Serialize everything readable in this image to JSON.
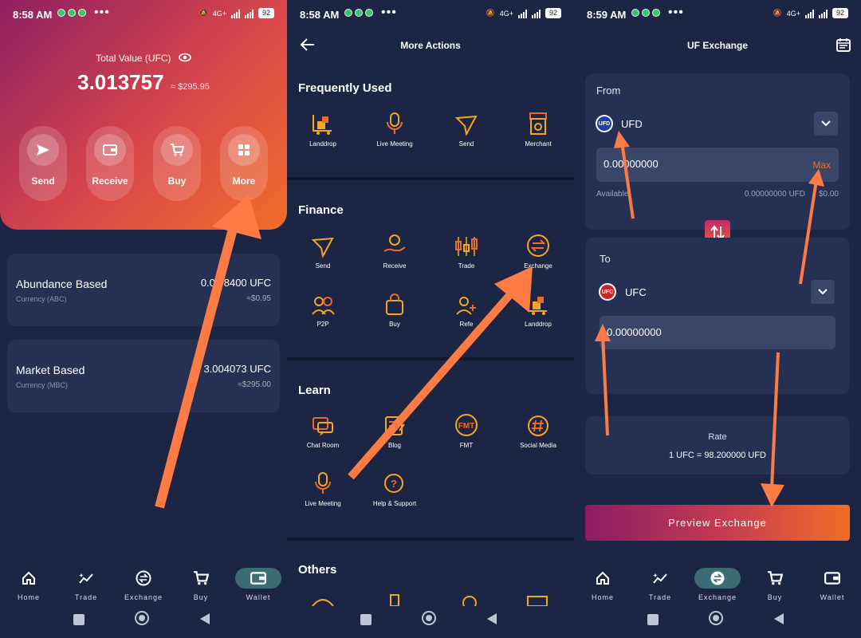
{
  "panel1": {
    "status": {
      "time": "8:58 AM",
      "more": "•••",
      "net": "4G+",
      "battery": "92"
    },
    "total_value_label": "Total Value (UFC)",
    "total_value": "3.013757",
    "total_value_usd": "≈ $295.95",
    "actions": [
      {
        "label": "Send",
        "icon": "send-icon"
      },
      {
        "label": "Receive",
        "icon": "wallet-icon"
      },
      {
        "label": "Buy",
        "icon": "cart-icon"
      },
      {
        "label": "More",
        "icon": "grid-icon"
      }
    ],
    "cards": [
      {
        "name": "Abundance Based",
        "sub": "Currency (ABC)",
        "amount": "0.009684 00 UFC",
        "amount_display": "0.00   8400 UFC",
        "usd": "≈$0.95"
      },
      {
        "name": "Market Based",
        "sub": "Currency (MBC)",
        "amount_display": "3.004073 UFC",
        "usd": "≈$295.00"
      }
    ],
    "nav": [
      {
        "label": "Home",
        "icon": "home-icon"
      },
      {
        "label": "Trade",
        "icon": "trade-icon"
      },
      {
        "label": "Exchange",
        "icon": "exchange-icon"
      },
      {
        "label": "Buy",
        "icon": "cart-icon"
      },
      {
        "label": "Wallet",
        "icon": "wallet-icon",
        "active": true
      }
    ]
  },
  "panel2": {
    "status": {
      "time": "8:58 AM",
      "more": "•••",
      "net": "4G+",
      "battery": "92"
    },
    "title": "More Actions",
    "sections": [
      {
        "title": "Frequently Used",
        "items": [
          {
            "label": "Landdrop",
            "icon": "landdrop-icon"
          },
          {
            "label": "Live Meeting",
            "icon": "microphone-icon"
          },
          {
            "label": "Send",
            "icon": "send-icon"
          },
          {
            "label": "Merchant",
            "icon": "store-icon"
          }
        ]
      },
      {
        "title": "Finance",
        "items": [
          {
            "label": "Send",
            "icon": "send-icon"
          },
          {
            "label": "Receive",
            "icon": "receive-icon"
          },
          {
            "label": "Trade",
            "icon": "candlestick-icon"
          },
          {
            "label": "Exchange",
            "icon": "exchange-icon"
          },
          {
            "label": "P2P",
            "icon": "users-icon"
          },
          {
            "label": "Buy",
            "icon": "bag-icon"
          },
          {
            "label": "Refe",
            "icon": "add-user-icon"
          },
          {
            "label": "Landdrop",
            "icon": "landdrop-icon"
          }
        ]
      },
      {
        "title": "Learn",
        "items": [
          {
            "label": "Chat Room",
            "icon": "chat-icon"
          },
          {
            "label": "Blog",
            "icon": "blog-icon"
          },
          {
            "label": "FMT",
            "icon": "fmt-icon"
          },
          {
            "label": "Social Media",
            "icon": "hashtag-icon"
          },
          {
            "label": "Live Meeting",
            "icon": "microphone-icon"
          },
          {
            "label": "Help & Support",
            "icon": "help-icon"
          }
        ]
      },
      {
        "title": "Others",
        "items": []
      }
    ]
  },
  "panel3": {
    "status": {
      "time": "8:59 AM",
      "more": "•••",
      "net": "4G+",
      "battery": "92"
    },
    "title": "UF Exchange",
    "from_label": "From",
    "from_coin": "UFD",
    "from_coin_badge": "UFD",
    "from_amount": "0.00000000",
    "max_label": "Max",
    "available_label": "Available",
    "available_value": "0.00000000 UFD",
    "available_usd": "$0.00",
    "to_label": "To",
    "to_coin": "UFC",
    "to_coin_badge": "UFC",
    "to_amount": "0.00000000",
    "rate_label": "Rate",
    "rate_value": "1 UFC = 98.200000 UFD",
    "preview_button": "Preview Exchange",
    "nav": [
      {
        "label": "Home",
        "icon": "home-icon"
      },
      {
        "label": "Trade",
        "icon": "trade-icon"
      },
      {
        "label": "Exchange",
        "icon": "exchange-icon",
        "active": true
      },
      {
        "label": "Buy",
        "icon": "cart-icon"
      },
      {
        "label": "Wallet",
        "icon": "wallet-icon"
      }
    ]
  },
  "colors": {
    "bg": "#1c2543",
    "card": "#253053",
    "accent_orange": "#f5a623",
    "arrow": "#ff7b45"
  }
}
